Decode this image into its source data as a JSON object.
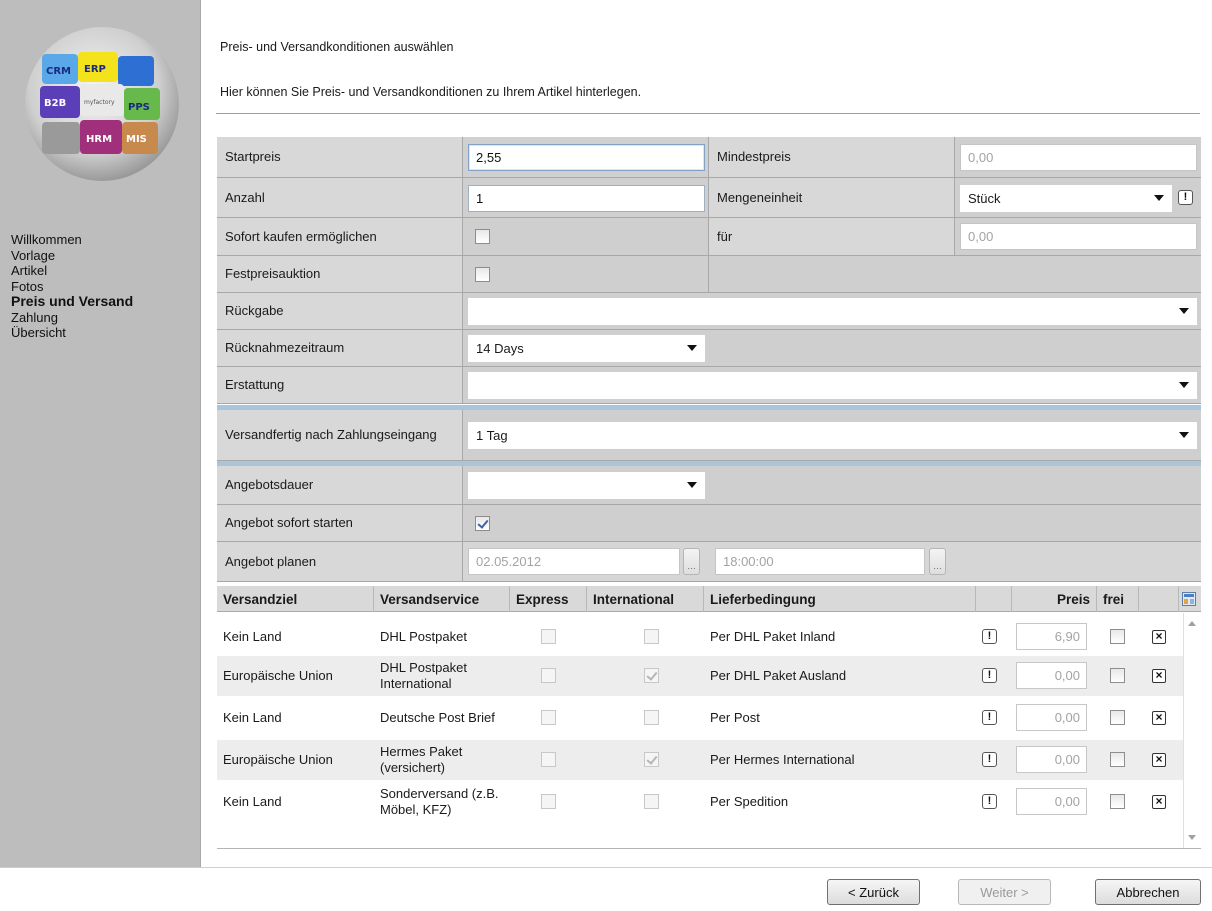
{
  "logo": {
    "labels": [
      "CRM",
      "ERP",
      "B2B",
      "myfactory",
      "PPS",
      "HRM",
      "MIS"
    ]
  },
  "nav": {
    "items": [
      "Willkommen",
      "Vorlage",
      "Artikel",
      "Fotos",
      "Preis und Versand",
      "Zahlung",
      "Übersicht"
    ],
    "active": "Preis und Versand"
  },
  "header": {
    "title": "Preis- und Versandkonditionen auswählen",
    "description": "Hier können Sie Preis- und Versandkonditionen zu Ihrem Artikel hinterlegen."
  },
  "form": {
    "startpreis": {
      "label": "Startpreis",
      "value": "2,55"
    },
    "mindestpreis": {
      "label": "Mindestpreis",
      "placeholder": "0,00"
    },
    "anzahl": {
      "label": "Anzahl",
      "value": "1"
    },
    "mengeneinheit": {
      "label": "Mengeneinheit",
      "value": "Stück"
    },
    "sofort_kaufen": {
      "label": "Sofort kaufen ermöglichen",
      "checked": false
    },
    "fuer": {
      "label": "für",
      "placeholder": "0,00"
    },
    "festpreisauktion": {
      "label": "Festpreisauktion",
      "checked": false
    },
    "rueckgabe": {
      "label": "Rückgabe",
      "value": ""
    },
    "ruecknahmezeitraum": {
      "label": "Rücknahmezeitraum",
      "value": "14 Days"
    },
    "erstattung": {
      "label": "Erstattung",
      "value": ""
    },
    "versandfertig": {
      "label": "Versandfertig nach Zahlungseingang",
      "value": "1 Tag"
    },
    "angebotsdauer": {
      "label": "Angebotsdauer",
      "value": ""
    },
    "angebot_sofort": {
      "label": "Angebot sofort starten",
      "checked": true
    },
    "angebot_planen": {
      "label": "Angebot planen",
      "date": "02.05.2012",
      "time": "18:00:00"
    }
  },
  "table": {
    "headers": {
      "versandziel": "Versandziel",
      "versandservice": "Versandservice",
      "express": "Express",
      "international": "International",
      "lieferbedingung": "Lieferbedingung",
      "preis": "Preis",
      "frei": "frei"
    },
    "rows": [
      {
        "ziel": "Kein Land",
        "service": "DHL Postpaket",
        "express": false,
        "international": false,
        "liefer": "Per DHL Paket Inland",
        "preis": "6,90",
        "frei": false
      },
      {
        "ziel": "Europäische Union",
        "service": "DHL Postpaket International",
        "express": false,
        "international": true,
        "liefer": "Per DHL Paket Ausland",
        "preis": "0,00",
        "frei": false
      },
      {
        "ziel": "Kein Land",
        "service": "Deutsche Post Brief",
        "express": false,
        "international": false,
        "liefer": "Per Post",
        "preis": "0,00",
        "frei": false
      },
      {
        "ziel": "Europäische Union",
        "service": "Hermes Paket (versichert)",
        "express": false,
        "international": true,
        "liefer": "Per Hermes International",
        "preis": "0,00",
        "frei": false
      },
      {
        "ziel": "Kein Land",
        "service": "Sonderversand (z.B. Möbel, KFZ)",
        "express": false,
        "international": false,
        "liefer": "Per Spedition",
        "preis": "0,00",
        "frei": false
      }
    ]
  },
  "footer": {
    "back": "< Zurück",
    "next": "Weiter >",
    "cancel": "Abbrechen"
  },
  "colors": {
    "divider": "#a9c4dd",
    "sidebar": "#bdbdbd",
    "row_alt": "#ededed"
  }
}
